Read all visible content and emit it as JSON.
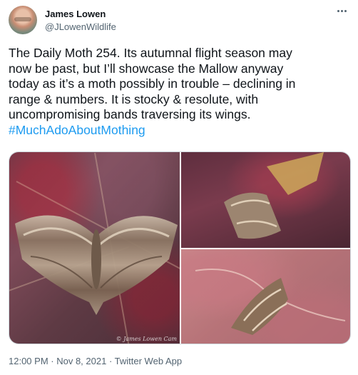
{
  "author": {
    "display_name": "James Lowen",
    "handle": "@JLowenWildlife"
  },
  "tweet": {
    "line1": "The Daily Moth 254. Its autumnal flight season may",
    "line2": "now be past, but I’ll showcase the Mallow anyway",
    "line3": "today as it’s a moth possibly in trouble – declining in",
    "line4": "range & numbers. It is stocky & resolute, with",
    "line5": "uncompromising bands traversing its wings.",
    "hashtag": "#MuchAdoAboutMothing"
  },
  "media": {
    "watermark": "© James Lowen Cam"
  },
  "meta": {
    "time": "12:00 PM",
    "separator1": " · ",
    "date": "Nov 8, 2021",
    "separator2": " · ",
    "source": "Twitter Web App"
  },
  "icons": {
    "more": "more-horizontal-icon"
  }
}
